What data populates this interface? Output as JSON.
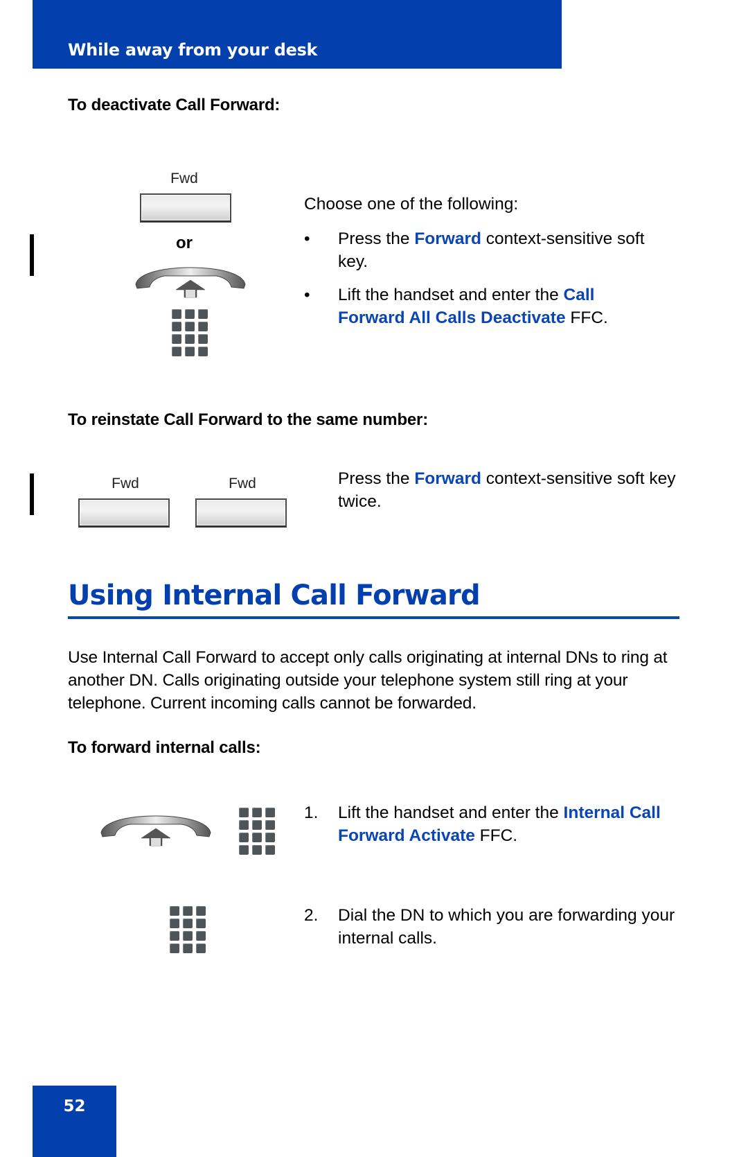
{
  "header": {
    "title": "While away from your desk"
  },
  "deactivate": {
    "heading": "To deactivate Call Forward:",
    "softkey_label": "Fwd",
    "or_label": "or",
    "intro": "Choose one of the following:",
    "bullets": [
      {
        "mark": "•",
        "pre": "Press the ",
        "highlight": "Forward",
        "post": " context-sensitive soft key."
      },
      {
        "mark": "•",
        "pre": "Lift the handset and enter the ",
        "highlight": "Call Forward All Calls Deactivate",
        "post": " FFC."
      }
    ]
  },
  "reinstate": {
    "heading": "To reinstate Call Forward to the same number:",
    "softkey_labels": [
      "Fwd",
      "Fwd"
    ],
    "pre": "Press the ",
    "highlight": "Forward",
    "post": " context-sensitive soft key twice."
  },
  "internal": {
    "title": "Using Internal Call Forward",
    "description": "Use Internal Call Forward to accept only calls originating at internal DNs to ring at another DN. Calls originating outside your telephone system still ring at your telephone. Current incoming calls cannot be forwarded.",
    "heading": "To forward internal calls:",
    "steps": [
      {
        "num": "1.",
        "pre": "Lift the handset and enter the ",
        "highlight": "Internal Call Forward Activate",
        "post": " FFC."
      },
      {
        "num": "2.",
        "pre": "Dial the DN to which you are forwarding your internal calls.",
        "highlight": "",
        "post": ""
      }
    ]
  },
  "footer": {
    "page_number": "52"
  },
  "colors": {
    "brand_blue": "#0340ad",
    "highlight_blue": "#0a45b4"
  }
}
